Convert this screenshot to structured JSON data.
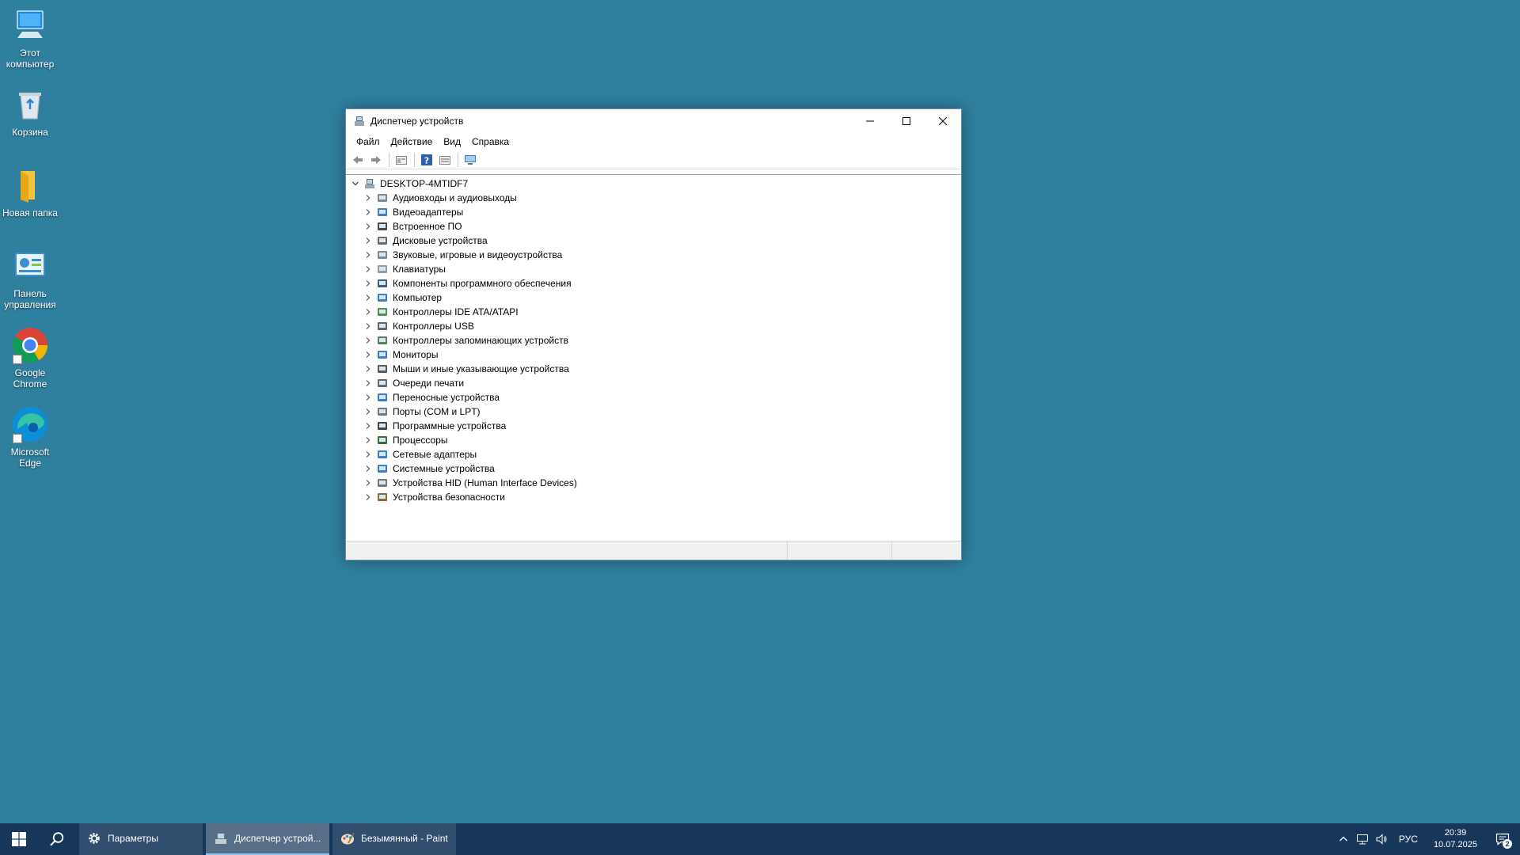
{
  "desktop": {
    "icons": [
      {
        "label": "Этот компьютер",
        "icon": "this-pc-icon"
      },
      {
        "label": "Корзина",
        "icon": "recycle-bin-icon"
      },
      {
        "label": "Новая папка",
        "icon": "folder-icon"
      },
      {
        "label": "Панель управления",
        "icon": "control-panel-icon"
      },
      {
        "label": "Google Chrome",
        "icon": "chrome-icon"
      },
      {
        "label": "Microsoft Edge",
        "icon": "edge-icon"
      }
    ]
  },
  "window": {
    "title": "Диспетчер устройств",
    "menu": [
      "Файл",
      "Действие",
      "Вид",
      "Справка"
    ],
    "toolbar": [
      "back-icon",
      "forward-icon",
      "properties-icon",
      "help-icon",
      "view-icon",
      "monitor-scan-icon"
    ],
    "tree": {
      "root": "DESKTOP-4MTIDF7",
      "categories": [
        "Аудиовходы и аудиовыходы",
        "Видеоадаптеры",
        "Встроенное ПО",
        "Дисковые устройства",
        "Звуковые, игровые и видеоустройства",
        "Клавиатуры",
        "Компоненты программного обеспечения",
        "Компьютер",
        "Контроллеры IDE ATA/ATAPI",
        "Контроллеры USB",
        "Контроллеры запоминающих устройств",
        "Мониторы",
        "Мыши и иные указывающие устройства",
        "Очереди печати",
        "Переносные устройства",
        "Порты (COM и LPT)",
        "Программные устройства",
        "Процессоры",
        "Сетевые адаптеры",
        "Системные устройства",
        "Устройства HID (Human Interface Devices)",
        "Устройства безопасности"
      ]
    }
  },
  "taskbar": {
    "items": [
      {
        "label": "Параметры",
        "icon": "settings-gear-icon",
        "active": false
      },
      {
        "label": "Диспетчер устрой...",
        "icon": "device-manager-icon",
        "active": true
      },
      {
        "label": "Безымянный - Paint",
        "icon": "paint-icon",
        "active": false
      }
    ],
    "language": "РУС",
    "time": "20:39",
    "date": "10.07.2025",
    "notifications": "2"
  },
  "colors": {
    "desktop": "#2f7f9e",
    "taskbar": "#16365a"
  }
}
